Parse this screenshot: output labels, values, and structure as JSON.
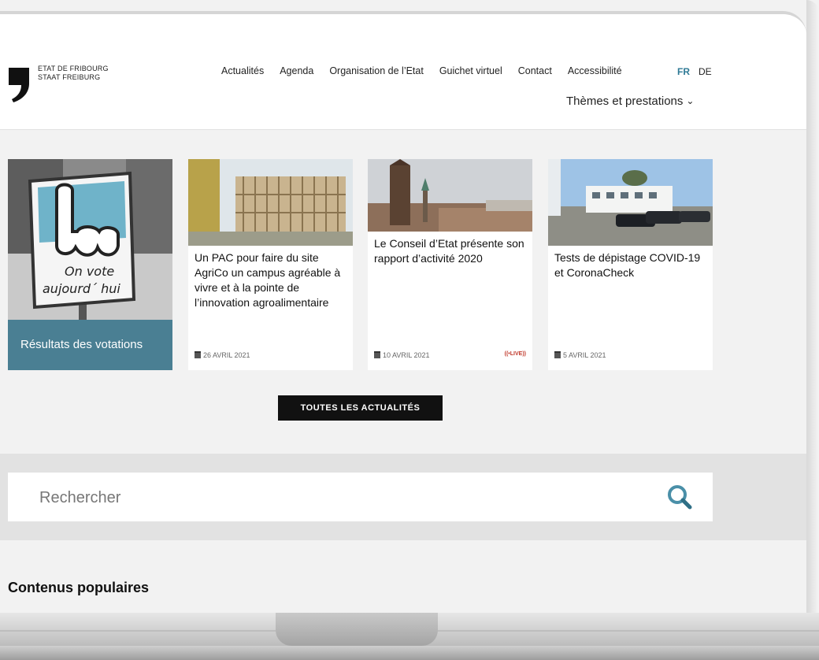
{
  "header": {
    "logo_line1": "ETAT DE FRIBOURG",
    "logo_line2": "STAAT FREIBURG",
    "nav": [
      "Actualités",
      "Agenda",
      "Organisation de l’Etat",
      "Guichet virtuel",
      "Contact",
      "Accessibilité"
    ],
    "lang_fr": "FR",
    "lang_de": "DE",
    "themes": "Thèmes et prestations"
  },
  "vote": {
    "sign_line1": "On vote",
    "sign_line2": "aujourd´ hui",
    "label": "Résultats des votations"
  },
  "cards": [
    {
      "title": "Un PAC pour faire du site AgriCo un campus agréable à vivre et à la pointe de l’innovation agroalimentaire",
      "date": "26 AVRIL 2021"
    },
    {
      "title": "Le Conseil d’Etat présente son rapport d’activité 2020",
      "date": "10 AVRIL 2021",
      "badge": "LIVE"
    },
    {
      "title": "Tests de dépistage COVID-19 et CoronaCheck",
      "date": "5 AVRIL 2021"
    }
  ],
  "cta": "TOUTES LES ACTUALITÉS",
  "search": {
    "placeholder": "Rechercher"
  },
  "popular": "Contenus populaires",
  "colors": {
    "accent": "#4a7f93",
    "lang_active": "#2f7a96",
    "cta_bg": "#111111"
  }
}
